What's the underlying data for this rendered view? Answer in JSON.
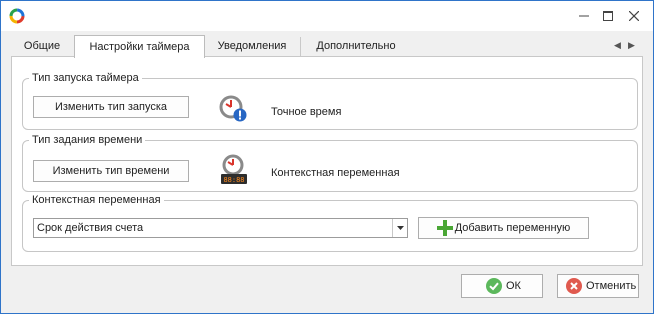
{
  "tabs": [
    {
      "label": "Общие"
    },
    {
      "label": "Настройки таймера"
    },
    {
      "label": "Уведомления"
    },
    {
      "label": "Дополнительно"
    }
  ],
  "groups": {
    "launch_type": {
      "title": "Тип запуска таймера",
      "button": "Изменить тип запуска",
      "value": "Точное время",
      "icon": "clock-info-icon"
    },
    "time_type": {
      "title": "Тип задания времени",
      "button": "Изменить тип времени",
      "value": "Контекстная переменная",
      "icon": "clock-digital-icon"
    },
    "context_var": {
      "title": "Контекстная переменная",
      "selected": "Срок действия счета",
      "add_button": "Добавить переменную",
      "icon": "plus-icon"
    }
  },
  "footer": {
    "ok_label": "ОК",
    "cancel_label": "Отменить"
  },
  "colors": {
    "accent_border": "#2f74c9",
    "ok_green": "#5cb85c",
    "cancel_red": "#e05a4f",
    "add_green": "#4aa635",
    "alert_blue": "#2867c4",
    "clock_red": "#d9342b"
  }
}
